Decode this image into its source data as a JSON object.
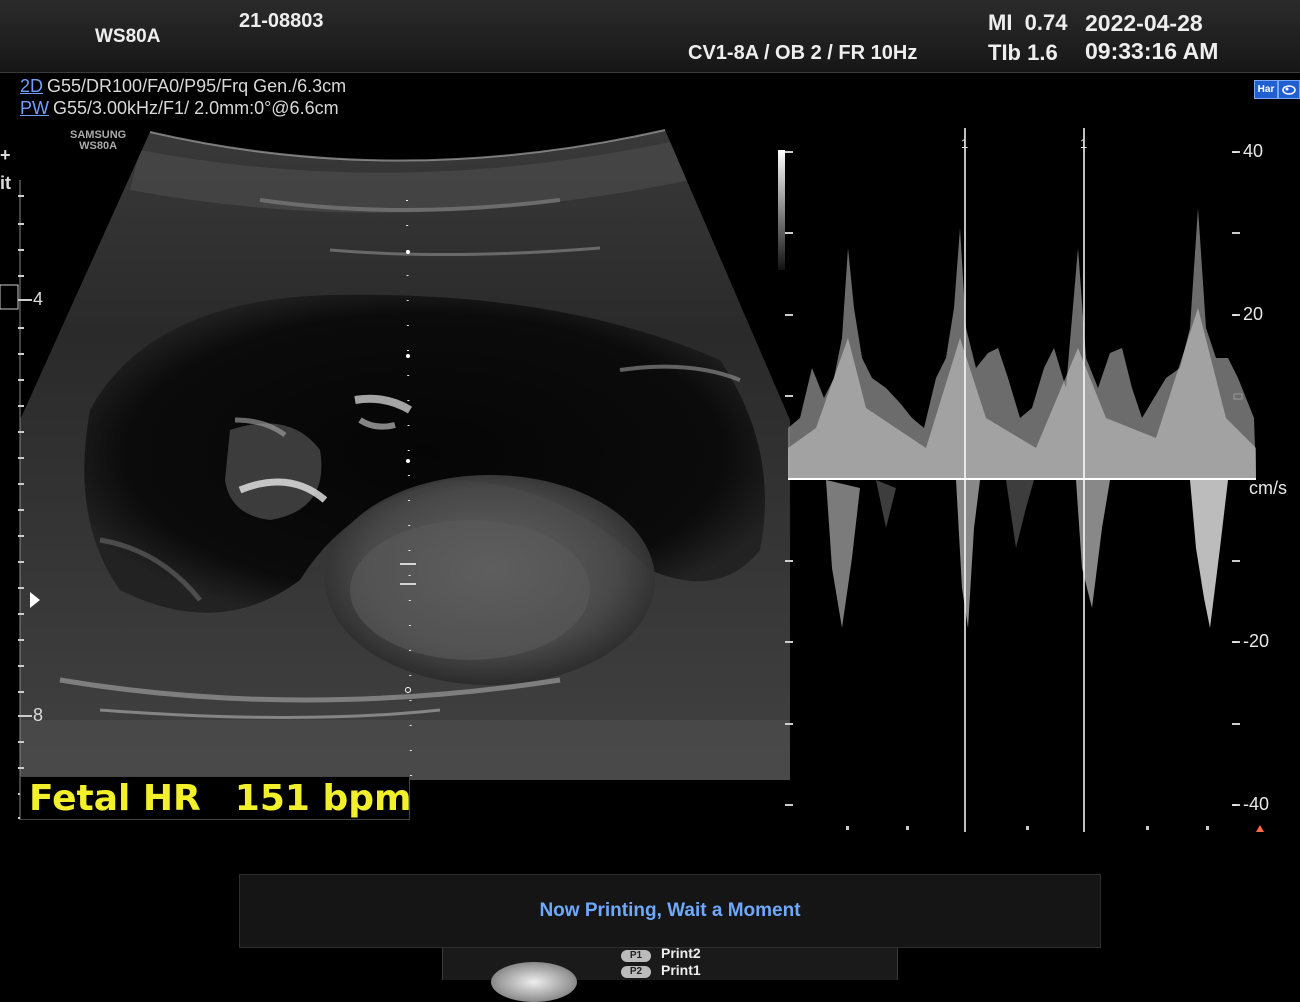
{
  "header": {
    "system": "WS80A",
    "patient_id": "21-08803",
    "probe_preset": "CV1-8A / OB 2 / FR 10Hz",
    "mi": "MI  0.74",
    "tib": "TIb 1.6",
    "date": "2022-04-28",
    "time": "09:33:16 AM"
  },
  "params": {
    "mode_2d": "2D",
    "line_2d": "G55/DR100/FA0/P95/Frq Gen./6.3cm",
    "mode_pw": "PW",
    "line_pw": "G55/3.00kHz/F1/ 2.0mm:0°@6.6cm"
  },
  "badges": {
    "har": "Har"
  },
  "image": {
    "logo_line1": "SAMSUNG",
    "logo_line2": "WS80A",
    "depth_4": "4",
    "depth_8": "8",
    "side_plus": "+",
    "side_it": "it"
  },
  "measurement": {
    "label": "Fetal HR",
    "value": "151 bpm"
  },
  "doppler": {
    "unit": "cm/s",
    "marker_1": "1",
    "marker_2": "1",
    "scale_labels": [
      "- 40",
      "- 20",
      "- -20",
      "- -40"
    ]
  },
  "message": {
    "text": "Now Printing, Wait a Moment"
  },
  "printer": {
    "p1_key": "P1",
    "p1_label": "Print2",
    "p2_key": "P2",
    "p2_label": "Print1"
  },
  "colors": {
    "accent": "#6ea8ff",
    "measurement": "#f2f02a"
  }
}
